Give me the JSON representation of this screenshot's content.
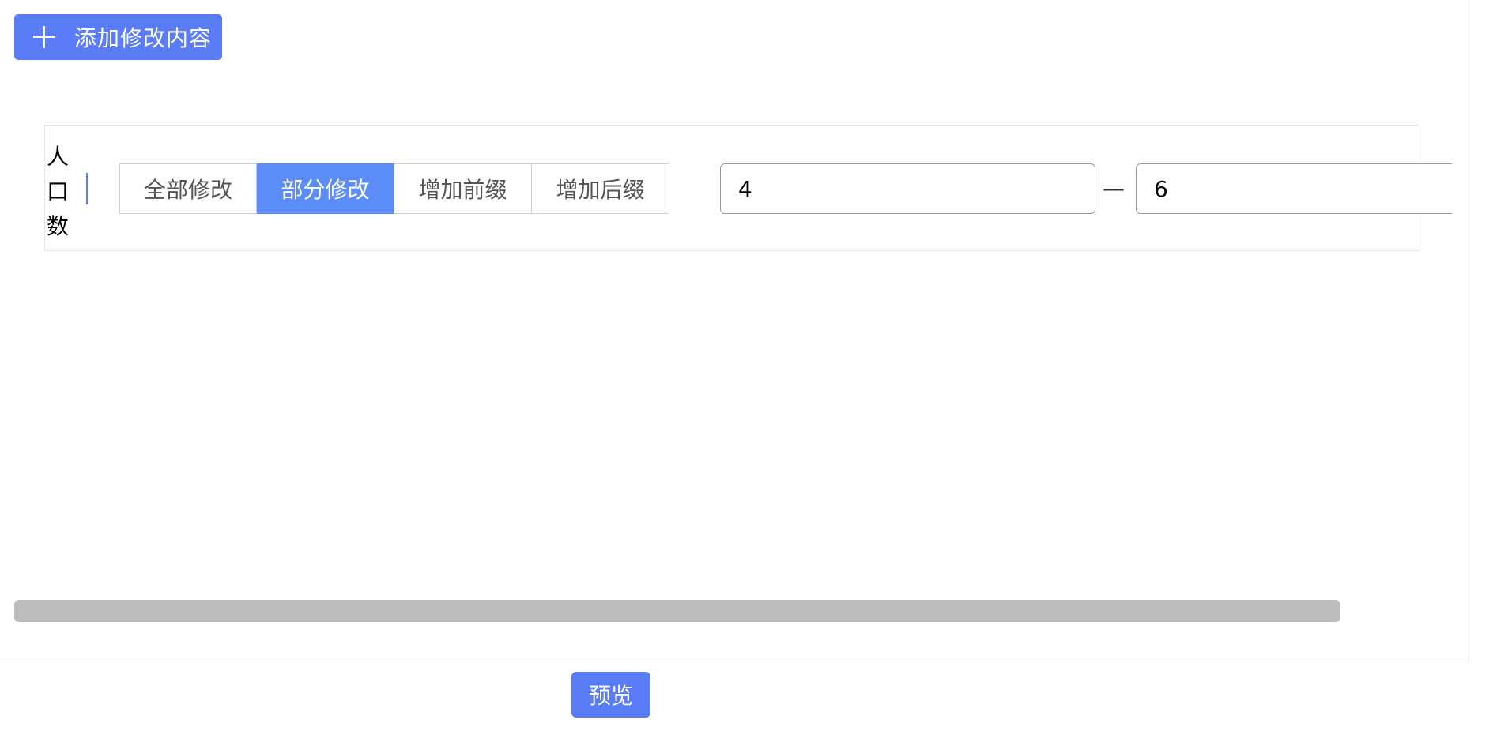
{
  "toolbar": {
    "add_icon": "plus-icon",
    "add_label": "添加修改内容"
  },
  "edit_row": {
    "field_label": [
      "人",
      "口",
      "数"
    ],
    "modes": [
      {
        "label": "全部修改",
        "active": false
      },
      {
        "label": "部分修改",
        "active": true
      },
      {
        "label": "增加前缀",
        "active": false
      },
      {
        "label": "增加后缀",
        "active": false
      }
    ],
    "range_from": "4",
    "range_separator": "—",
    "range_to": "6"
  },
  "footer": {
    "preview_label": "预览"
  },
  "colors": {
    "primary": "#5b7cf7",
    "active_mode": "#5b8cf7",
    "scrollbar": "#bdbdbd"
  }
}
